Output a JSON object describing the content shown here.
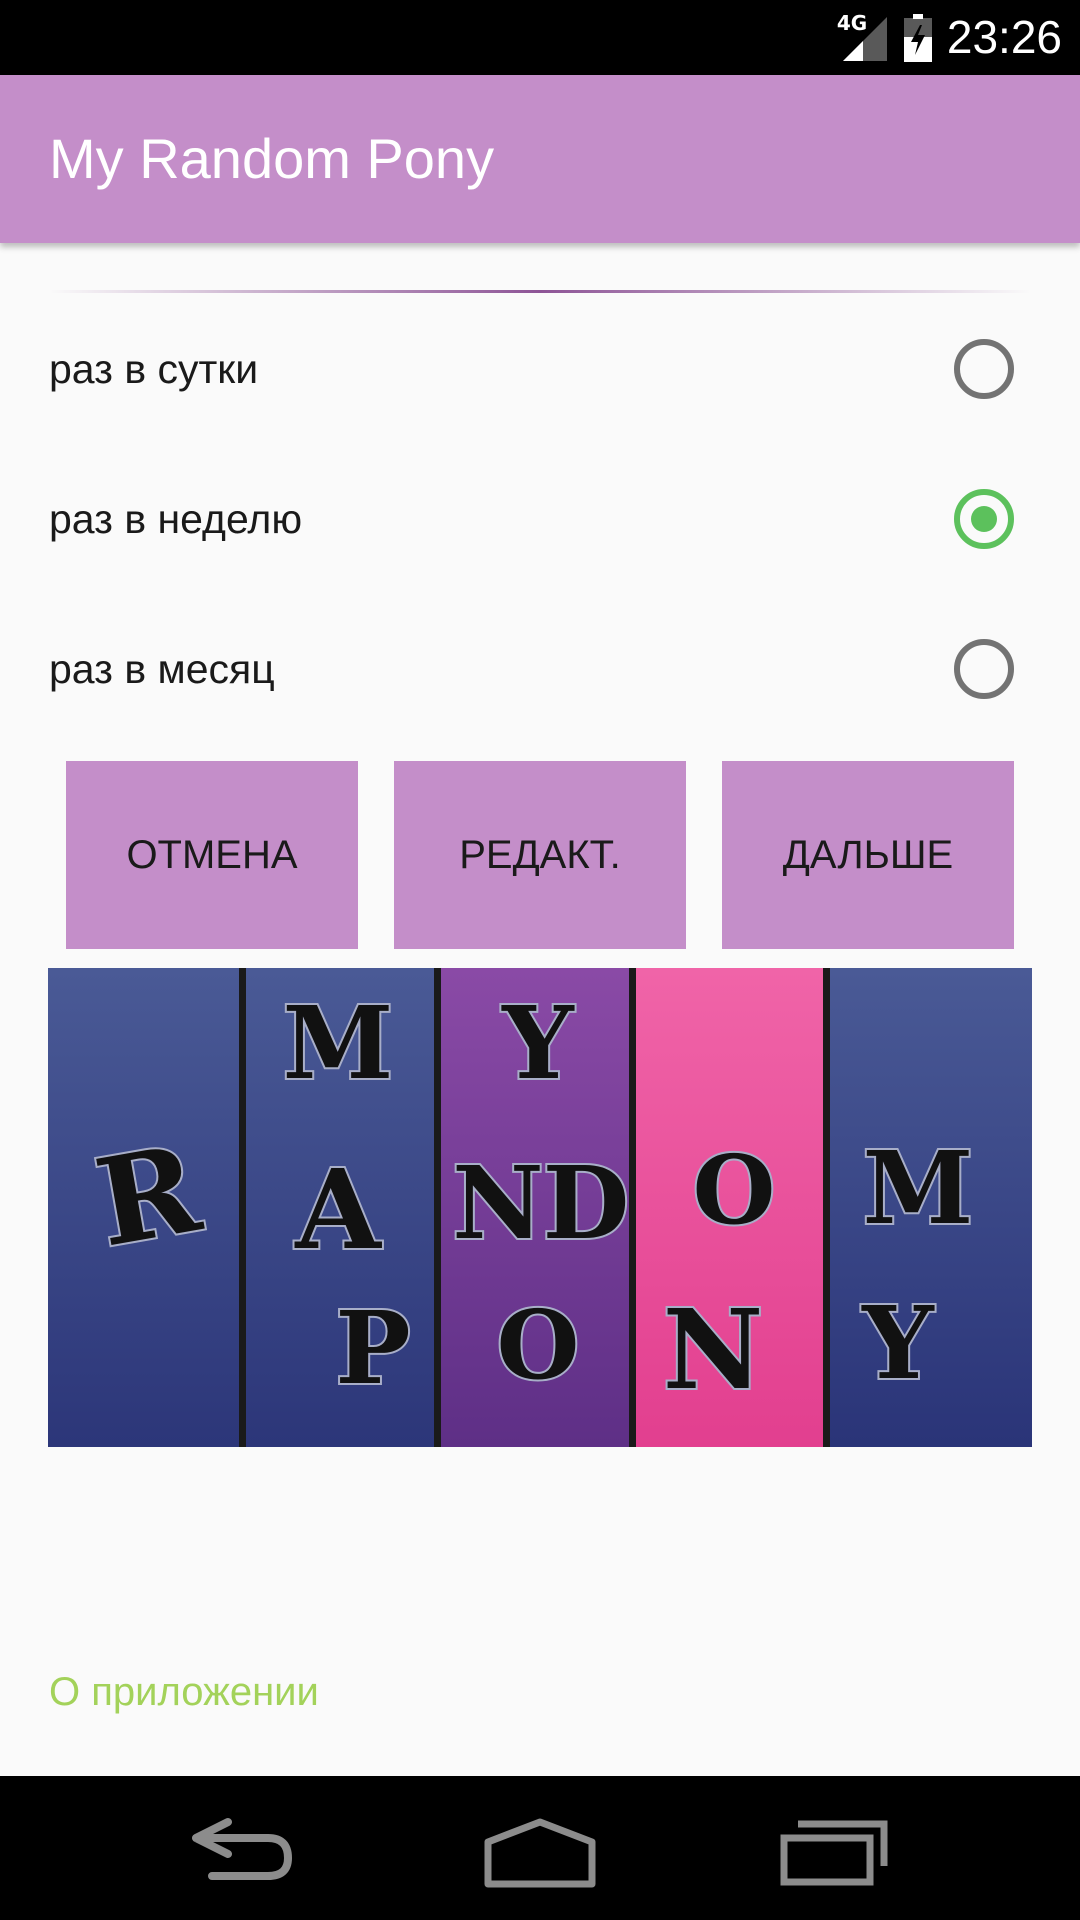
{
  "status_bar": {
    "network": "4G",
    "time": "23:26"
  },
  "app_bar": {
    "title": "My Random Pony"
  },
  "frequency_options": [
    {
      "label": "раз в сутки",
      "checked": false
    },
    {
      "label": "раз в неделю",
      "checked": true
    },
    {
      "label": "раз в месяц",
      "checked": false
    }
  ],
  "buttons": {
    "cancel_label": "ОТМЕНА",
    "edit_label": "РЕДАКТ.",
    "next_label": "ДАЛЬШЕ"
  },
  "banner": {
    "panel_colors": [
      "#3e4c8a",
      "#3a4686",
      "#7a3d9a",
      "#ec509e",
      "#34407e"
    ],
    "letters": [
      "M",
      "Y",
      "R",
      "A",
      "N",
      "D",
      "O",
      "M",
      "P",
      "O",
      "N",
      "Y"
    ]
  },
  "footer": {
    "about_label": "О приложении"
  },
  "colors": {
    "accent": "#c48ec9",
    "radio_checked": "#5cc15c",
    "radio_unchecked": "#737373",
    "link": "#a3d25a"
  },
  "nav_bar": {
    "back_icon": "back-icon",
    "home_icon": "home-icon",
    "recent_icon": "recent-apps-icon"
  }
}
